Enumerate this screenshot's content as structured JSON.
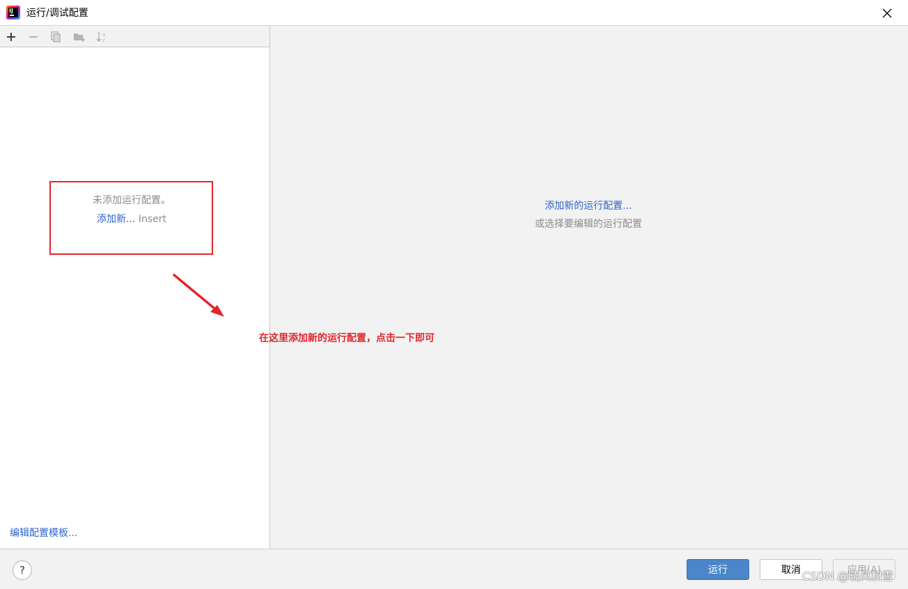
{
  "window": {
    "title": "运行/调试配置"
  },
  "toolbar": {
    "icons": [
      "add-icon",
      "remove-icon",
      "copy-icon",
      "folder-add-icon",
      "sort-icon"
    ]
  },
  "left_panel": {
    "empty_message": "未添加运行配置。",
    "add_new_link": "添加新...",
    "add_new_shortcut": "Insert",
    "edit_templates_link": "编辑配置模板..."
  },
  "right_panel": {
    "add_new_link": "添加新的运行配置...",
    "subtext": "或选择要编辑的运行配置"
  },
  "buttons": {
    "help": "?",
    "run": "运行",
    "cancel": "取消",
    "apply": "应用(A)"
  },
  "annotation": {
    "text": "在这里添加新的运行配置，点击一下即可",
    "color": "#e3262b"
  },
  "watermark": "CSDN @晓风和雪",
  "colors": {
    "link": "#2f65ca",
    "primary_button": "#4a86c8",
    "hint_text": "#8c8c8c"
  }
}
